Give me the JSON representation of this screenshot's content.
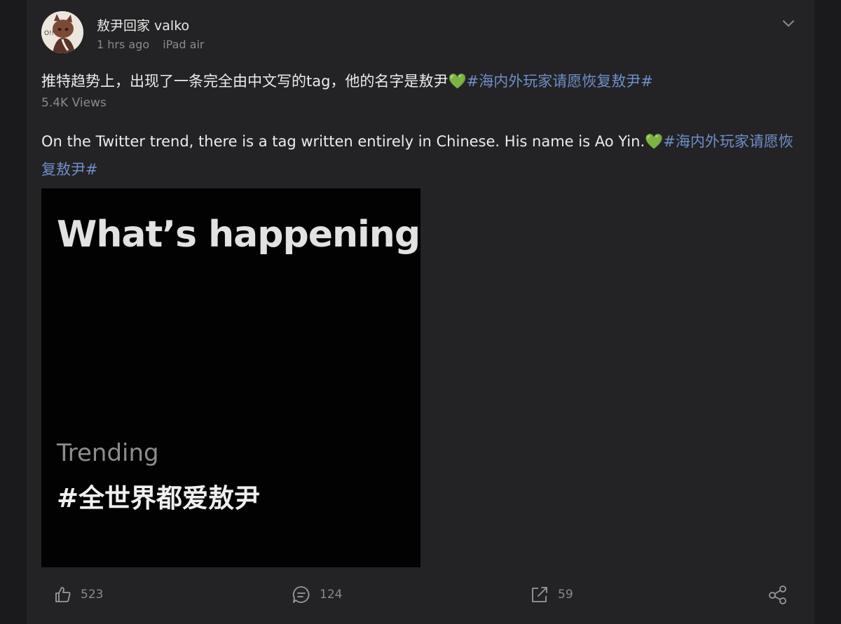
{
  "post": {
    "username": "敖尹回家 valko",
    "time": "1 hrs ago",
    "device": "iPad air",
    "text": "推特趋势上，出现了一条完全由中文写的tag，他的名字是敖尹",
    "heart_emoji": "💚",
    "hashtag": "#海内外玩家请愿恢复敖尹#",
    "views": "5.4K Views",
    "translation_text": "On the Twitter trend, there is a tag written entirely in Chinese. His name is Ao Yin.",
    "translation_heart": "💚",
    "translation_hashtag": "#海内外玩家请愿恢复敖尹#"
  },
  "image": {
    "heading": "What’s happening",
    "trending_label": "Trending",
    "trending_tag": "#全世界都爱敖尹"
  },
  "actions": {
    "likes": "523",
    "comments": "124",
    "reposts": "59"
  },
  "icons": {
    "more": "chevron-down-icon",
    "like": "thumbs-up-icon",
    "comment": "comment-bubble-icon",
    "repost": "repost-arrow-icon",
    "share": "share-icon"
  },
  "colors": {
    "background": "#1a1a1c",
    "card": "#232325",
    "hashtag": "#6e8fc7",
    "secondary_text": "#8a8a8e"
  }
}
